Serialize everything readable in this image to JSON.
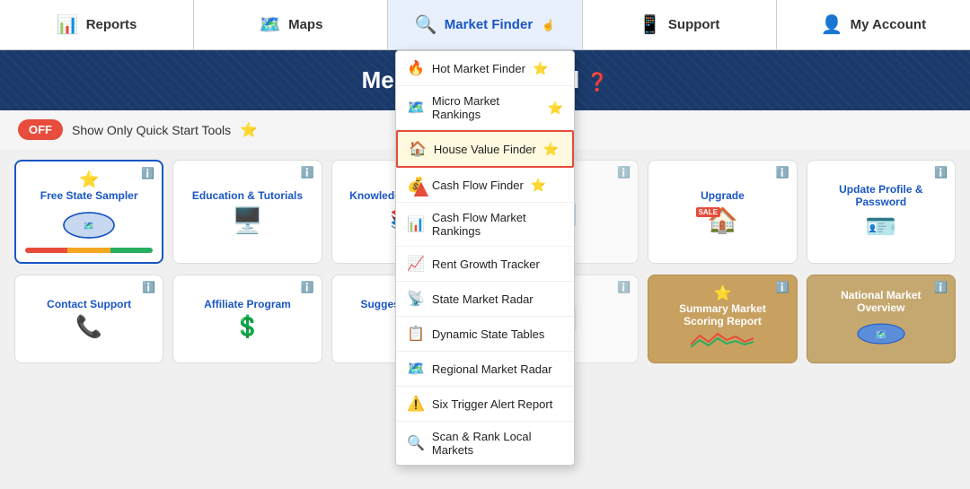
{
  "navbar": {
    "items": [
      {
        "id": "reports",
        "label": "Reports",
        "icon": "📊"
      },
      {
        "id": "maps",
        "label": "Maps",
        "icon": "🗺️"
      },
      {
        "id": "market-finder",
        "label": "Market Finder",
        "icon": "🔍",
        "active": true
      },
      {
        "id": "support",
        "label": "Support",
        "icon": "📱"
      },
      {
        "id": "my-account",
        "label": "My Account",
        "icon": "👤"
      }
    ]
  },
  "hero": {
    "title": "Member Dashboard",
    "icon": "❓"
  },
  "quickbar": {
    "toggle_label": "OFF",
    "label": "Show Only Quick Start Tools",
    "star": "⭐"
  },
  "dropdown": {
    "items": [
      {
        "id": "hot-market-finder",
        "label": "Hot Market Finder",
        "icon": "🔥",
        "star": true,
        "highlighted": false
      },
      {
        "id": "micro-market-rankings",
        "label": "Micro Market Rankings",
        "icon": "🗺️",
        "star": true,
        "highlighted": false
      },
      {
        "id": "house-value-finder",
        "label": "House Value Finder",
        "icon": "🏠",
        "star": true,
        "highlighted": true
      },
      {
        "id": "cash-flow-finder",
        "label": "Cash Flow Finder",
        "icon": "💰",
        "star": true,
        "highlighted": false
      },
      {
        "id": "cash-flow-market-rankings",
        "label": "Cash Flow Market Rankings",
        "icon": "📊",
        "star": false,
        "highlighted": false
      },
      {
        "id": "rent-growth-tracker",
        "label": "Rent Growth Tracker",
        "icon": "📈",
        "star": false,
        "highlighted": false
      },
      {
        "id": "state-market-radar",
        "label": "State Market Radar",
        "icon": "📡",
        "star": false,
        "highlighted": false
      },
      {
        "id": "dynamic-state-tables",
        "label": "Dynamic State Tables",
        "icon": "📋",
        "star": false,
        "highlighted": false
      },
      {
        "id": "regional-market-radar",
        "label": "Regional Market Radar",
        "icon": "🗺️",
        "star": false,
        "highlighted": false
      },
      {
        "id": "six-trigger-alert-report",
        "label": "Six Trigger Alert Report",
        "icon": "⚠️",
        "star": false,
        "highlighted": false
      },
      {
        "id": "scan-rank-local-markets",
        "label": "Scan & Rank Local Markets",
        "icon": "🔍",
        "star": false,
        "highlighted": false
      }
    ]
  },
  "cards": {
    "row1": [
      {
        "id": "free-state-sampler",
        "title": "Free State Sampler",
        "info": true,
        "type": "free-state",
        "star": true
      },
      {
        "id": "education-tutorials",
        "title": "Education & Tutorials",
        "info": true,
        "type": "default"
      },
      {
        "id": "knowledge-support",
        "title": "Knowledge & Support",
        "info": true,
        "type": "default"
      },
      {
        "id": "report-col",
        "title": "",
        "info": true,
        "type": "default"
      },
      {
        "id": "upgrade",
        "title": "Upgrade",
        "info": true,
        "type": "upgrade"
      },
      {
        "id": "update-profile",
        "title": "Update Profile & Password",
        "info": true,
        "type": "default"
      }
    ],
    "row2": [
      {
        "id": "contact-support",
        "title": "Contact Support",
        "info": true,
        "type": "default"
      },
      {
        "id": "affiliate-program",
        "title": "Affiliate Program",
        "info": true,
        "type": "default"
      },
      {
        "id": "suggest",
        "title": "Suggest Features",
        "info": false,
        "type": "suggest"
      },
      {
        "id": "partial",
        "title": "",
        "info": true,
        "type": "default"
      },
      {
        "id": "summary-market",
        "title": "Summary Market Scoring Report",
        "info": true,
        "type": "summary-market"
      },
      {
        "id": "national-market",
        "title": "National Market Overview",
        "info": true,
        "type": "national-market"
      }
    ]
  }
}
